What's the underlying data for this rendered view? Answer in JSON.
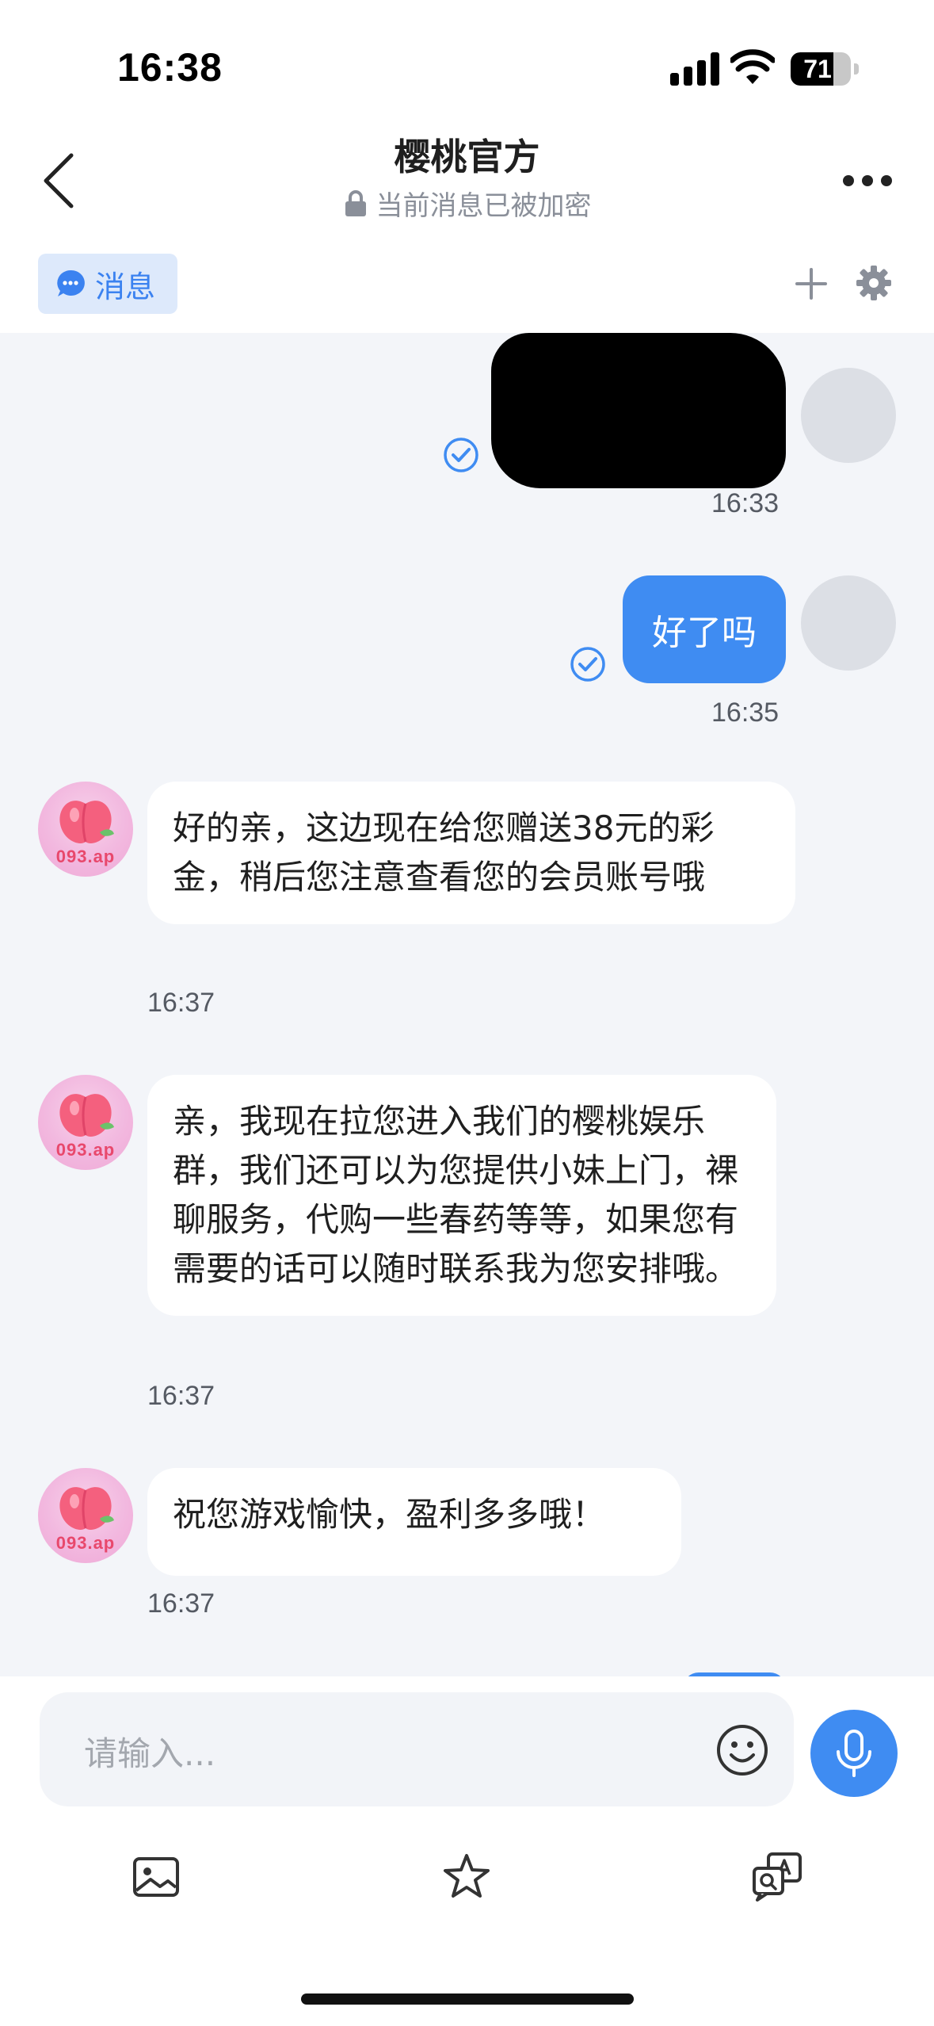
{
  "status_bar": {
    "time": "16:38",
    "battery": "71",
    "battery_level": 0.71
  },
  "header": {
    "title": "樱桃官方",
    "subtitle": "当前消息已被加密"
  },
  "tabs": {
    "messages_label": "消息"
  },
  "messages": [
    {
      "side": "out",
      "content": "",
      "redacted": true,
      "time": "16:33",
      "read": true
    },
    {
      "side": "out",
      "content": "好了吗",
      "time": "16:35",
      "read": true
    },
    {
      "side": "in",
      "content": "好的亲，这边现在给您赠送38元的彩金，稍后您注意查看您的会员账号哦",
      "time": "16:37"
    },
    {
      "side": "in",
      "content": "亲，我现在拉您进入我们的樱桃娱乐群，我们还可以为您提供小妹上门，裸聊服务，代购一些春药等等，如果您有需要的话可以随时联系我为您安排哦。",
      "time": "16:37"
    },
    {
      "side": "in",
      "content": "祝您游戏愉快，盈利多多哦！",
      "time": "16:37"
    }
  ],
  "bot_avatar": {
    "logo_text": "093.ap"
  },
  "input": {
    "placeholder": "请输入..."
  },
  "colors": {
    "accent": "#3f8cf2",
    "chat_bg": "#f3f5f9",
    "tab_bg": "#dde9fb"
  },
  "icons": [
    "chevron-left-icon",
    "lock-icon",
    "more-icon",
    "chat-bubble-icon",
    "plus-icon",
    "gear-icon",
    "read-check-icon",
    "emoji-icon",
    "mic-icon",
    "image-icon",
    "star-icon",
    "translate-icon"
  ]
}
